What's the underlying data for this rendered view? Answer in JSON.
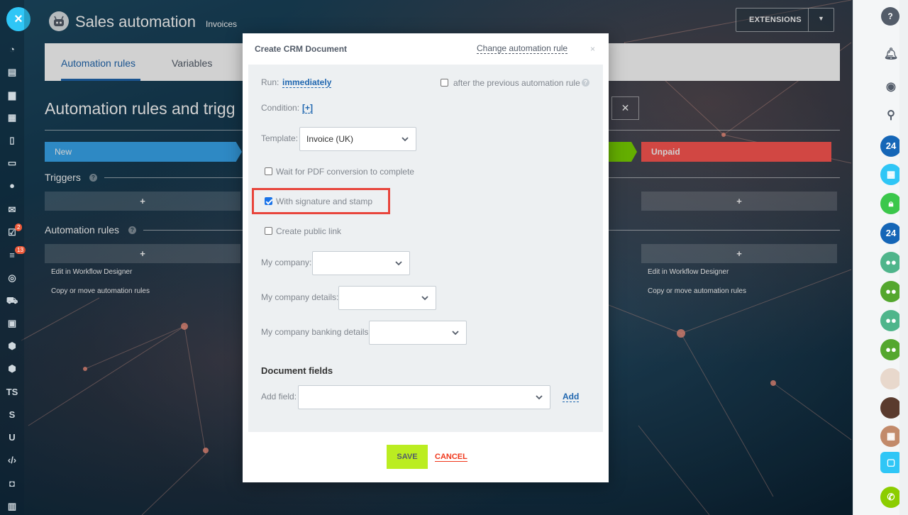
{
  "header": {
    "app_title": "Sales automation",
    "app_subtitle": "Invoices",
    "extensions_label": "EXTENSIONS"
  },
  "tabs": [
    {
      "label": "Automation rules",
      "active": true
    },
    {
      "label": "Variables",
      "active": false
    }
  ],
  "page": {
    "heading": "Automation rules and trigg",
    "stages": [
      {
        "label": "New",
        "color": "#39a8ef"
      },
      {
        "label": "",
        "color": "#7bd500"
      },
      {
        "label": "Unpaid",
        "color": "#ff5752"
      }
    ],
    "triggers_title": "Triggers",
    "automation_rules_title": "Automation rules",
    "add_symbol": "+",
    "edit_designer": "Edit in Workflow Designer",
    "copy_move": "Copy or move automation rules",
    "help_symbol": "?"
  },
  "left_sidebar": {
    "close_symbol": "×",
    "badges": [
      "2",
      "13"
    ],
    "text_items": [
      "TS",
      "S",
      "U"
    ]
  },
  "right_sidebar": {
    "labels": [
      "?",
      "24",
      "24"
    ]
  },
  "dialog": {
    "title": "Create CRM Document",
    "change_link": "Change automation rule",
    "close_symbol": "×",
    "run_label": "Run:",
    "run_value": "immediately",
    "after_previous_label": "after the previous automation rule",
    "after_previous_checked": false,
    "condition_label": "Condition:",
    "condition_value": "[+]",
    "template_label": "Template:",
    "template_value": "Invoice (UK)",
    "wait_pdf_label": "Wait for PDF conversion to complete",
    "wait_pdf_checked": false,
    "signature_label": "With signature and stamp",
    "signature_checked": true,
    "public_link_label": "Create public link",
    "public_link_checked": false,
    "my_company_label": "My company:",
    "my_company_details_label": "My company details:",
    "my_company_banking_label": "My company banking details:",
    "document_fields_title": "Document fields",
    "add_field_label": "Add field:",
    "add_button": "Add",
    "save_button": "SAVE",
    "cancel_button": "CANCEL"
  },
  "colors": {
    "accent_blue": "#2067b0",
    "save_green": "#bbed21",
    "cancel_red": "#f0371b",
    "highlight_red": "#e8453c"
  }
}
